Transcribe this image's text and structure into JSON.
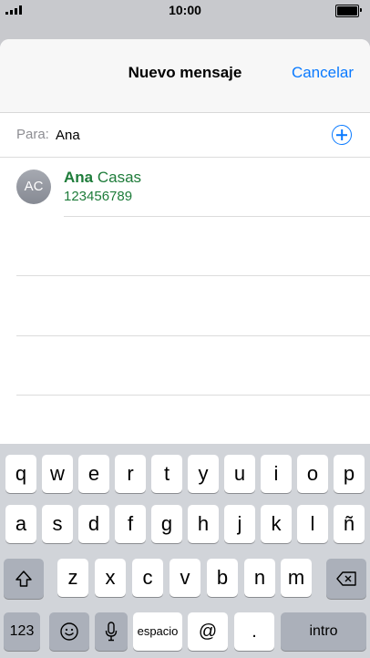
{
  "status": {
    "time": "10:00"
  },
  "nav": {
    "title": "Nuevo mensaje",
    "cancel": "Cancelar"
  },
  "to": {
    "label": "Para:",
    "value": "Ana"
  },
  "suggestion": {
    "initials": "AC",
    "first_name": "Ana",
    "last_name": "Casas",
    "phone": "123456789"
  },
  "keyboard": {
    "row1": [
      "q",
      "w",
      "e",
      "r",
      "t",
      "y",
      "u",
      "i",
      "o",
      "p"
    ],
    "row2": [
      "a",
      "s",
      "d",
      "f",
      "g",
      "h",
      "j",
      "k",
      "l",
      "ñ"
    ],
    "row3": [
      "z",
      "x",
      "c",
      "v",
      "b",
      "n",
      "m"
    ],
    "numbers": "123",
    "space": "espacio",
    "at": "@",
    "dot": ".",
    "return": "intro"
  },
  "colors": {
    "accent": "#0a7aff",
    "contact": "#1e7c3a"
  },
  "icons": [
    "signal-icon",
    "battery-icon",
    "add-contact-icon",
    "shift-icon",
    "delete-icon",
    "emoji-icon",
    "microphone-icon"
  ]
}
